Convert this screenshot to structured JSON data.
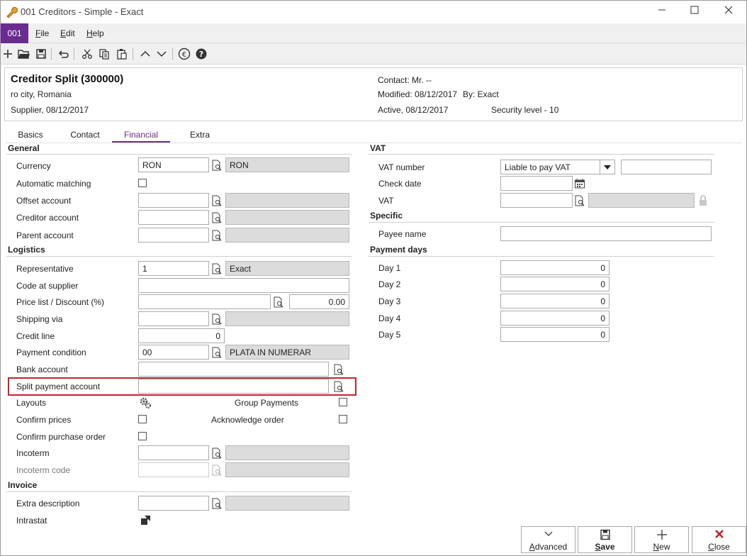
{
  "window": {
    "title": "001 Creditors - Simple - Exact",
    "minimize": "—",
    "maximize": "☐",
    "close": "✕"
  },
  "menubar": {
    "company": "001",
    "items": [
      {
        "label": "File",
        "key": "F",
        "rest": "ile"
      },
      {
        "label": "Edit",
        "key": "E",
        "rest": "dit"
      },
      {
        "label": "Help",
        "key": "H",
        "rest": "elp"
      }
    ]
  },
  "toolbar": {
    "icons": [
      "new-icon",
      "open-icon",
      "save-icon",
      "undo-icon",
      "cut-icon",
      "copy-icon",
      "paste-icon",
      "previous-icon",
      "next-icon",
      "currency-icon",
      "help-icon"
    ]
  },
  "header": {
    "name": "Creditor Split (300000)",
    "city": "ro city, Romania",
    "supplier": "Supplier, 08/12/2017",
    "contact": "Contact: Mr. --",
    "modified": "Modified: 08/12/2017",
    "modified_by": "By: Exact",
    "active": "Active, 08/12/2017",
    "security": "Security level - 10"
  },
  "tabs": [
    "Basics",
    "Contact",
    "Financial",
    "Extra"
  ],
  "active_tab": "Financial",
  "general": {
    "title": "General",
    "currency_label": "Currency",
    "currency_code": "RON",
    "currency_desc": "RON",
    "automatic_matching_label": "Automatic matching",
    "offset_account_label": "Offset account",
    "creditor_account_label": "Creditor account",
    "parent_account_label": "Parent account"
  },
  "logistics": {
    "title": "Logistics",
    "representative_label": "Representative",
    "representative_code": "1",
    "representative_name": "Exact",
    "code_at_supplier_label": "Code at supplier",
    "price_list_label": "Price list / Discount (%)",
    "discount_value": "0.00",
    "shipping_via_label": "Shipping via",
    "credit_line_label": "Credit line",
    "credit_line_value": "0",
    "payment_condition_label": "Payment condition",
    "payment_condition_code": "00",
    "payment_condition_desc": "PLATA IN NUMERAR",
    "bank_account_label": "Bank account",
    "split_payment_account_label": "Split payment account",
    "layouts_label": "Layouts",
    "group_payments_label": "Group Payments",
    "confirm_prices_label": "Confirm prices",
    "acknowledge_order_label": "Acknowledge order",
    "confirm_purchase_order_label": "Confirm purchase order",
    "incoterm_label": "Incoterm",
    "incoterm_code_label": "Incoterm code"
  },
  "invoice": {
    "title": "Invoice",
    "extra_description_label": "Extra description",
    "intrastat_label": "Intrastat"
  },
  "vat": {
    "title": "VAT",
    "vat_number_label": "VAT number",
    "vat_number_select": "Liable to pay VAT",
    "check_date_label": "Check date",
    "vat_label": "VAT"
  },
  "specific": {
    "title": "Specific",
    "payee_name_label": "Payee name"
  },
  "payment_days": {
    "title": "Payment days",
    "days": [
      {
        "label": "Day 1",
        "value": "0"
      },
      {
        "label": "Day 2",
        "value": "0"
      },
      {
        "label": "Day 3",
        "value": "0"
      },
      {
        "label": "Day 4",
        "value": "0"
      },
      {
        "label": "Day 5",
        "value": "0"
      }
    ]
  },
  "buttons": {
    "advanced": {
      "label": "Advanced",
      "key": "A",
      "rest": "dvanced"
    },
    "save": {
      "label": "Save",
      "key": "S",
      "rest": "ave"
    },
    "new": {
      "label": "New",
      "key": "N",
      "rest": "ew"
    },
    "close": {
      "label": "Close",
      "key": "C",
      "rest": "lose"
    }
  },
  "colors": {
    "accent": "#6a2c91",
    "highlight_border": "#c0262d",
    "readonly_fill": "#dcdcdc",
    "close_icon": "#c0262d"
  }
}
